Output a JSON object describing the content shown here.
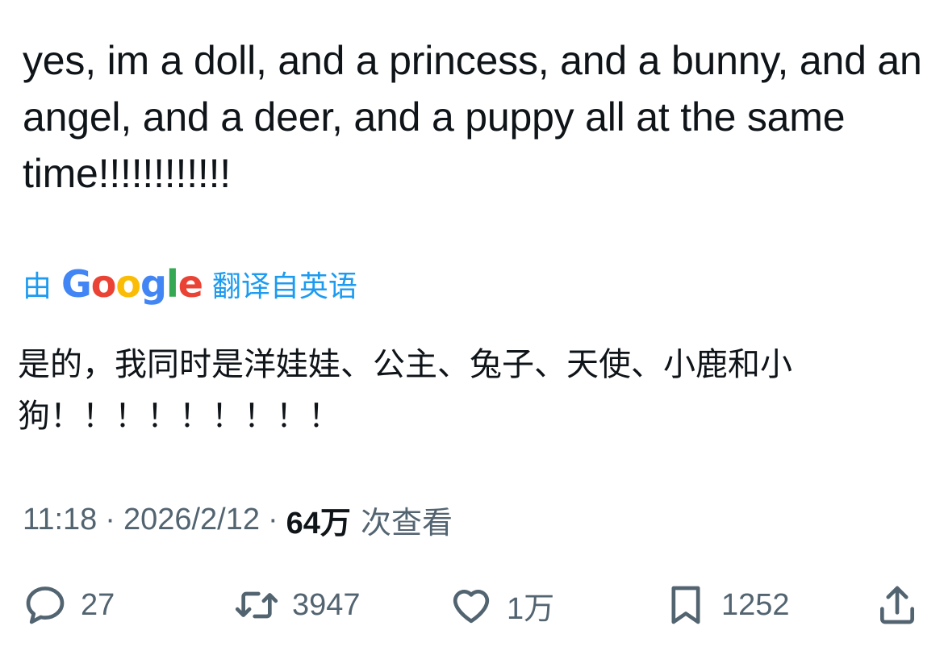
{
  "tweet": {
    "text": "yes, im a doll, and a princess, and a bunny, and an angel, and a deer, and a puppy all at the same time!!!!!!!!!!!!"
  },
  "translation": {
    "prefix": "由",
    "provider_letters": [
      "G",
      "o",
      "o",
      "g",
      "l",
      "e"
    ],
    "provider_colors": [
      "#4285F4",
      "#EA4335",
      "#FBBC05",
      "#4285F4",
      "#34A853",
      "#EA4335"
    ],
    "suffix": "翻译自英语",
    "text": "是的，我同时是洋娃娃、公主、兔子、天使、小鹿和小狗！！！！！！！！！",
    "link_color": "#1d9bf0"
  },
  "meta": {
    "time": "11:18",
    "separator": "·",
    "date": "2026/2/12",
    "views_count": "64万",
    "views_label": "次查看"
  },
  "actions": {
    "reply": {
      "icon": "reply-icon",
      "count": "27"
    },
    "retweet": {
      "icon": "retweet-icon",
      "count": "3947"
    },
    "like": {
      "icon": "heart-icon",
      "count": "1万"
    },
    "bookmark": {
      "icon": "bookmark-icon",
      "count": "1252"
    },
    "share": {
      "icon": "share-icon"
    }
  },
  "colors": {
    "text": "#0f1419",
    "secondary": "#536471",
    "accent": "#1d9bf0"
  }
}
